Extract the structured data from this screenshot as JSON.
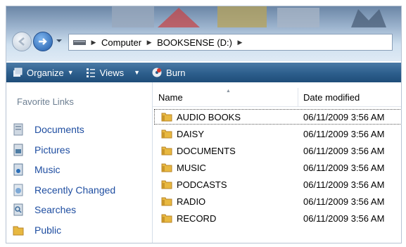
{
  "address_bar": {
    "crumbs": [
      "Computer",
      "BOOKSENSE (D:)"
    ]
  },
  "toolbar": {
    "organize_label": "Organize",
    "views_label": "Views",
    "burn_label": "Burn"
  },
  "favorites": {
    "title": "Favorite Links",
    "items": [
      {
        "label": "Documents",
        "icon": "documents-icon"
      },
      {
        "label": "Pictures",
        "icon": "pictures-icon"
      },
      {
        "label": "Music",
        "icon": "music-icon"
      },
      {
        "label": "Recently Changed",
        "icon": "recently-changed-icon"
      },
      {
        "label": "Searches",
        "icon": "searches-icon"
      },
      {
        "label": "Public",
        "icon": "public-folder-icon"
      }
    ]
  },
  "file_list": {
    "columns": {
      "name": "Name",
      "date": "Date modified"
    },
    "rows": [
      {
        "name": "AUDIO BOOKS",
        "date": "06/11/2009 3:56 AM"
      },
      {
        "name": "DAISY",
        "date": "06/11/2009 3:56 AM"
      },
      {
        "name": "DOCUMENTS",
        "date": "06/11/2009 3:56 AM"
      },
      {
        "name": "MUSIC",
        "date": "06/11/2009 3:56 AM"
      },
      {
        "name": "PODCASTS",
        "date": "06/11/2009 3:56 AM"
      },
      {
        "name": "RADIO",
        "date": "06/11/2009 3:56 AM"
      },
      {
        "name": "RECORD",
        "date": "06/11/2009 3:56 AM"
      }
    ]
  },
  "colors": {
    "command_bar": "#2c5e8c",
    "link_text": "#1f4ea1",
    "folder": "#e8b840"
  }
}
